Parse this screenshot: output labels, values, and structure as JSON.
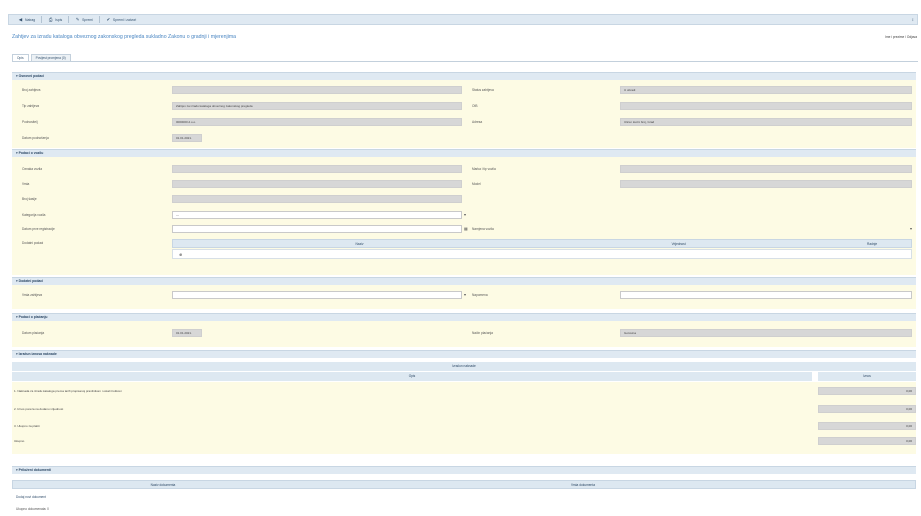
{
  "toolbar": {
    "items": [
      {
        "icon": "back-icon",
        "glyph": "◀",
        "label": "Natrag"
      },
      {
        "icon": "print-icon",
        "glyph": "⎙",
        "label": "Ispis"
      },
      {
        "icon": "edit-icon",
        "glyph": "✎",
        "label": "Spremi"
      },
      {
        "icon": "save-icon",
        "glyph": "✔",
        "label": "Spremi i zatvori"
      }
    ],
    "right_glyph": "↕"
  },
  "page": {
    "title": "Zahtjev za izradu kataloga obveznog zakonskog pregleda sukladno Zakonu o gradnji i mjerenjima",
    "user": "Ime i prezime / Odjava"
  },
  "tabs": [
    {
      "label": "Opis",
      "active": true
    },
    {
      "label": "Povijest promjena (0)",
      "active": false
    }
  ],
  "sections": {
    "s1": {
      "title": "▾ Osnovni podaci",
      "left_labels": [
        "Broj zahtjeva",
        "Tip zahtjeva",
        "Podnositelj",
        "Datum podnošenja"
      ],
      "left_values": [
        "",
        "Zahtjev za izradu kataloga obveznog zakonskog pregleda",
        "0000000 d.o.o.",
        "01.01.2021."
      ],
      "right_labels": [
        "Status zahtjeva",
        "OIB",
        "Adresa"
      ],
      "right_values": [
        "U obradi",
        "",
        "Ulica i kućni broj, Grad"
      ]
    },
    "s2": {
      "title": "▾ Podaci o vozilu",
      "left_labels": [
        "Oznaka vozila",
        "Vrsta",
        "Broj šasije",
        "Kategorija vozila",
        "Datum prve registracije",
        "Dodatni podaci"
      ],
      "right_labels": [
        "Marka i tip vozila",
        "Model",
        "Namjena vozila"
      ],
      "select_value": "---",
      "date_value": "",
      "table_headers": [
        "",
        "Naziv",
        "Vrijednost",
        "Radnje"
      ]
    },
    "s3": {
      "title": "▾ Dodatni podaci",
      "label": "Vrsta zahtjeva",
      "right_label": "Napomena"
    },
    "s4": {
      "title": "▾ Podaci o plaćanju",
      "label": "Datum plaćanja",
      "date_value": "01.01.2021.",
      "right_label": "Način plaćanja",
      "right_value": "Gotovina"
    },
    "s5": {
      "title": "▾ Izračun iznosa naknade",
      "table_title": "Izračun naknade",
      "col_head": "Opis",
      "col_value": "Iznos",
      "rows": [
        {
          "label": "1. Naknada za izradu kataloga prema tarifi propisanoj pravilnikom i ostali troškovi",
          "value": "0,00"
        },
        {
          "label": "2. Iznos poreza na dodanu vrijednost",
          "value": "0,00"
        },
        {
          "label": "3. Ukupno za platiti",
          "value": "0,00"
        },
        {
          "label": "Ukupno",
          "value": "0,00"
        }
      ]
    },
    "s6": {
      "title": "▾ Priloženi dokumenti",
      "table_headers": [
        "",
        "Naziv dokumenta",
        "Vrsta dokumenta"
      ],
      "link": "Dodaj novi dokument",
      "foot": "Ukupno dokumenata: 0"
    }
  }
}
